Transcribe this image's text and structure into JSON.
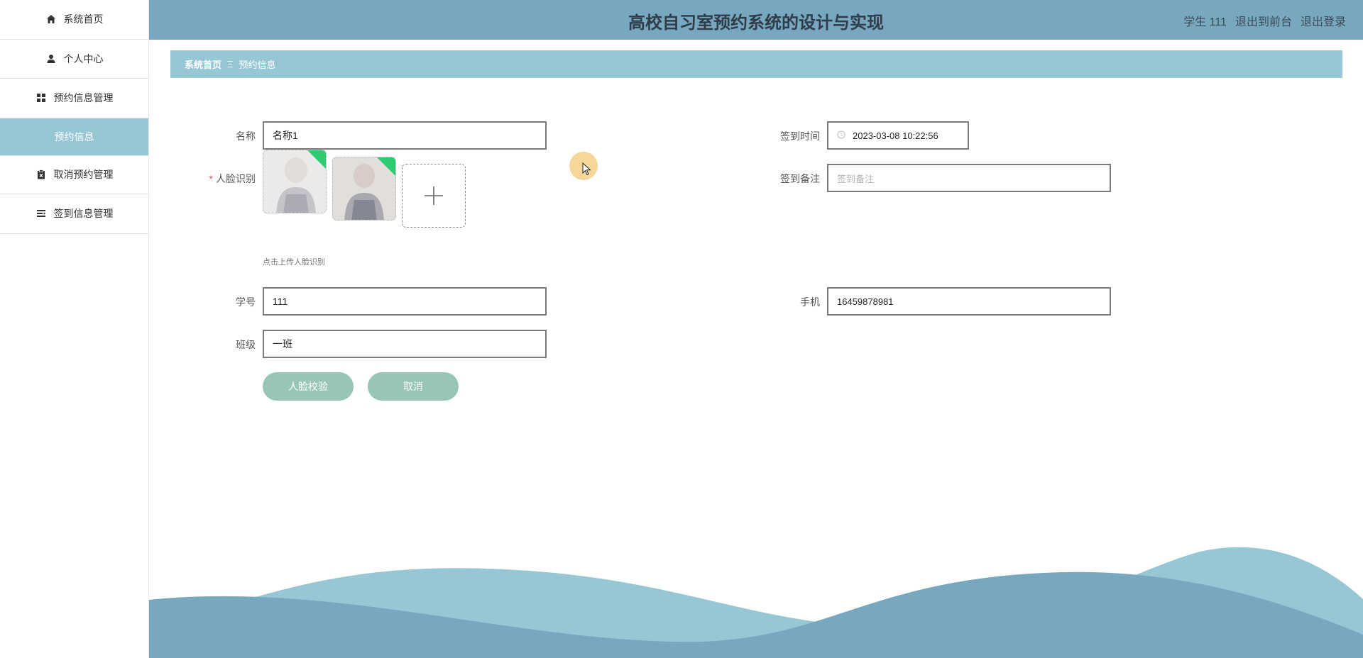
{
  "app": {
    "title": "高校自习室预约系统的设计与实现",
    "user": "学生 111",
    "link_front": "退出到前台",
    "link_logout": "退出登录"
  },
  "sidebar": {
    "items": [
      {
        "label": "系统首页",
        "icon": "home-icon"
      },
      {
        "label": "个人中心",
        "icon": "user-icon"
      },
      {
        "label": "预约信息管理",
        "icon": "grid-icon"
      },
      {
        "label": "预约信息",
        "icon": ""
      },
      {
        "label": "取消预约管理",
        "icon": "clipboard-x-icon"
      },
      {
        "label": "签到信息管理",
        "icon": "list-icon"
      }
    ]
  },
  "breadcrumb": {
    "home": "系统首页",
    "separator": "Ξ",
    "current": "预约信息"
  },
  "form": {
    "name": {
      "label": "名称",
      "value": "名称1"
    },
    "face": {
      "label": "人脸识别",
      "required_mark": "*",
      "hint": "点击上传人脸识别"
    },
    "checkin_time": {
      "label": "签到时间",
      "value": "2023-03-08 10:22:56"
    },
    "checkin_note": {
      "label": "签到备注",
      "placeholder": "签到备注"
    },
    "student_no": {
      "label": "学号",
      "value": "111"
    },
    "phone": {
      "label": "手机",
      "value": "16459878981"
    },
    "class": {
      "label": "班级",
      "value": "一班"
    }
  },
  "buttons": {
    "face_verify": "人脸校验",
    "cancel": "取消"
  },
  "colors": {
    "header_bg": "#78a8c0",
    "breadcrumb_bg": "#97c7d5",
    "button_bg": "#97c6b6",
    "wave_light": "#97c7d5",
    "wave_dark": "#78a8c0"
  }
}
